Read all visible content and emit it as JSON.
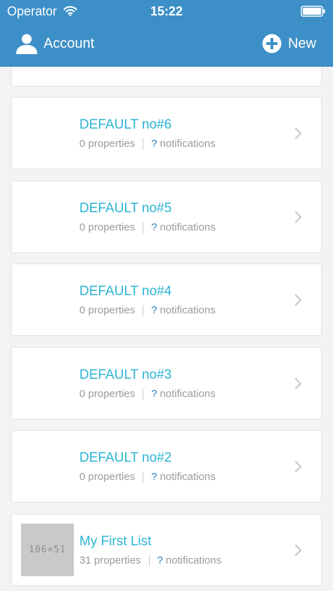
{
  "status_bar": {
    "carrier": "Operator",
    "time": "15:22"
  },
  "nav": {
    "account_label": "Account",
    "new_label": "New"
  },
  "lists": [
    {
      "title": "DEFAULT no#6",
      "properties": "0 properties",
      "notifications_count": "?",
      "notifications_label": "notifications",
      "thumbnail": ""
    },
    {
      "title": "DEFAULT no#5",
      "properties": "0 properties",
      "notifications_count": "?",
      "notifications_label": "notifications",
      "thumbnail": ""
    },
    {
      "title": "DEFAULT no#4",
      "properties": "0 properties",
      "notifications_count": "?",
      "notifications_label": "notifications",
      "thumbnail": ""
    },
    {
      "title": "DEFAULT no#3",
      "properties": "0 properties",
      "notifications_count": "?",
      "notifications_label": "notifications",
      "thumbnail": ""
    },
    {
      "title": "DEFAULT no#2",
      "properties": "0 properties",
      "notifications_count": "?",
      "notifications_label": "notifications",
      "thumbnail": ""
    },
    {
      "title": "My First List",
      "properties": "31 properties",
      "notifications_count": "?",
      "notifications_label": "notifications",
      "thumbnail": "106×51"
    }
  ],
  "colors": {
    "nav_background": "#3d8fc7",
    "title_text": "#2ab4d4",
    "meta_text": "#9a9a9a",
    "notification_mark": "#2a7fbf"
  },
  "icons": [
    "wifi-icon",
    "battery-icon",
    "user-icon",
    "plus-circle-icon",
    "chevron-right-icon"
  ]
}
